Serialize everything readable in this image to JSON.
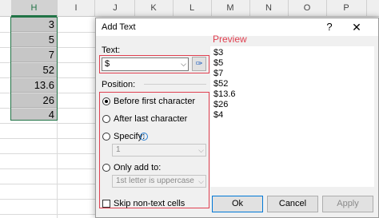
{
  "sheet": {
    "columns": [
      "H",
      "I",
      "J",
      "K",
      "L",
      "M",
      "N",
      "O",
      "P"
    ],
    "cells": [
      "3",
      "5",
      "7",
      "52",
      "13.6",
      "26",
      "4"
    ]
  },
  "dialog": {
    "title": "Add Text",
    "help_glyph": "?",
    "close_glyph": "✕",
    "text_label": "Text:",
    "text_value": "$",
    "preview_label": "Preview",
    "preview_items": [
      "$3",
      "$5",
      "$7",
      "$52",
      "$13.6",
      "$26",
      "$4"
    ],
    "position_label": "Position:",
    "options": {
      "before_first": "Before first character",
      "after_last": "After last character",
      "specify": "Specify:",
      "only_add_to": "Only add to:"
    },
    "specify_value": "1",
    "only_add_to_value": "1st letter is uppercase",
    "skip_label": "Skip non-text cells",
    "buttons": {
      "ok": "Ok",
      "cancel": "Cancel",
      "apply": "Apply"
    },
    "selected_option": "before_first",
    "accent_color": "#e04050"
  }
}
